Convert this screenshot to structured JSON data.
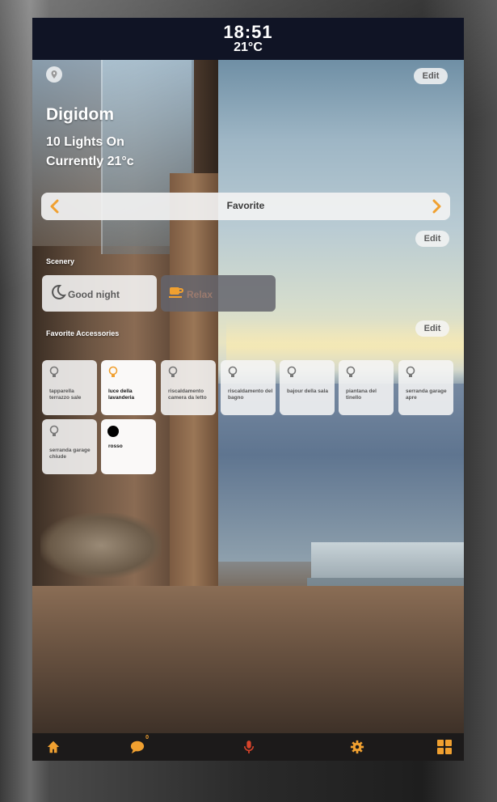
{
  "status": {
    "time": "18:51",
    "temperature": "21°C"
  },
  "home": {
    "title": "Digidom",
    "lights_on": "10 Lights On",
    "current_temp": "Currently 21°c",
    "edit_label": "Edit"
  },
  "favorites_bar": {
    "label": "Favorite",
    "edit_label": "Edit"
  },
  "scenery": {
    "heading": "Scenery",
    "items": [
      {
        "label": "Good night",
        "icon": "moon-icon",
        "active": true
      },
      {
        "label": "Relax",
        "icon": "cup-icon",
        "active": false
      }
    ]
  },
  "accessories": {
    "heading": "Favorite Accessories",
    "edit_label": "Edit",
    "items": [
      {
        "name": "tapparella terrazzo sale",
        "icon": "bulb-icon",
        "on": false
      },
      {
        "name": "luce della lavanderia",
        "icon": "bulb-icon",
        "on": true
      },
      {
        "name": "riscaldamento camera da letto",
        "icon": "bulb-icon",
        "on": false
      },
      {
        "name": "riscaldamento del bagno",
        "icon": "bulb-icon",
        "on": false
      },
      {
        "name": "bajour della sala",
        "icon": "bulb-icon",
        "on": false
      },
      {
        "name": "piantana del tinello",
        "icon": "bulb-icon",
        "on": false
      },
      {
        "name": "serranda garage apre",
        "icon": "bulb-icon",
        "on": false
      },
      {
        "name": "serranda garage chiude",
        "icon": "bulb-icon",
        "on": false
      },
      {
        "name": "rosso",
        "icon": "color-dot-icon",
        "on": true
      }
    ]
  },
  "navbar": {
    "items": [
      {
        "icon": "home-icon"
      },
      {
        "icon": "chat-icon",
        "badge": "0"
      },
      {
        "icon": "microphone-icon"
      },
      {
        "icon": "gear-icon"
      },
      {
        "icon": "grid-icon"
      }
    ]
  },
  "colors": {
    "accent": "#f0a030",
    "mic": "#d9442b",
    "navbar_bg": "#1c1a1a"
  }
}
